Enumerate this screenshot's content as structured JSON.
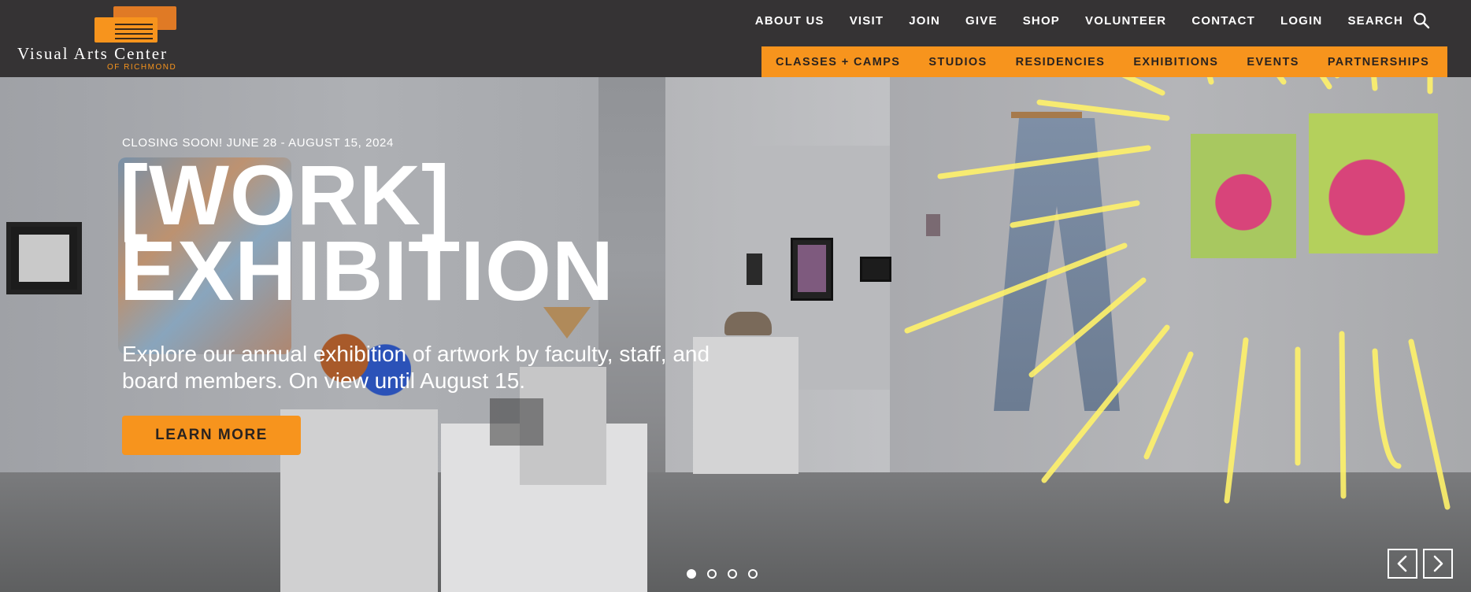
{
  "brand": {
    "name": "Visual Arts Center",
    "subtitle": "OF RICHMOND",
    "accent": "#f7941d"
  },
  "nav_primary": [
    "ABOUT US",
    "VISIT",
    "JOIN",
    "GIVE",
    "SHOP",
    "VOLUNTEER",
    "CONTACT",
    "LOGIN",
    "SEARCH"
  ],
  "nav_secondary": [
    "CLASSES + CAMPS",
    "STUDIOS",
    "RESIDENCIES",
    "EXHIBITIONS",
    "EVENTS",
    "PARTNERSHIPS"
  ],
  "hero": {
    "kicker": "CLOSING SOON! JUNE 28 - AUGUST 15, 2024",
    "headline_line1": "[WORK]",
    "headline_line2": "EXHIBITION",
    "description": "Explore our annual exhibition of artwork by faculty, staff, and board members. On view until August 15.",
    "cta_label": "LEARN MORE"
  },
  "slider": {
    "slide_count": 4,
    "active_index": 0,
    "prev_icon": "chevron-left-icon",
    "next_icon": "chevron-right-icon"
  },
  "icons": {
    "search": "search-icon"
  }
}
